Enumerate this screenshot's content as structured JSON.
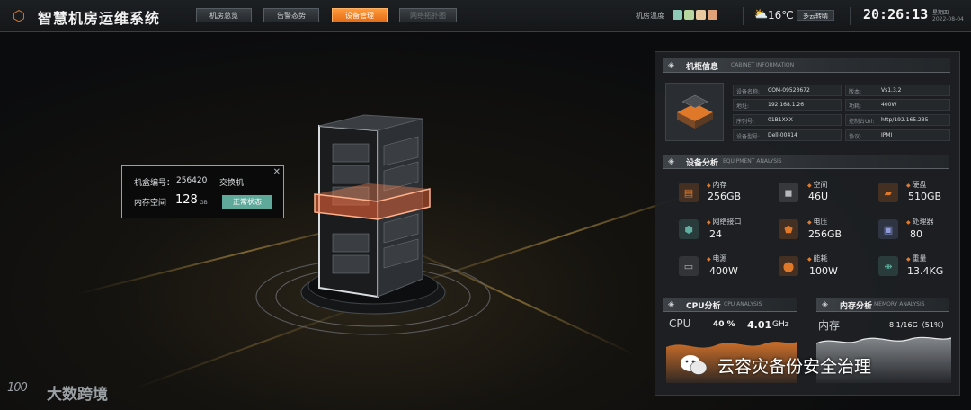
{
  "header": {
    "app_title": "智慧机房运维系统",
    "nav_items": [
      {
        "label": "机房总览",
        "state": "normal"
      },
      {
        "label": "告警态势",
        "state": "normal"
      },
      {
        "label": "设备管理",
        "state": "active"
      },
      {
        "label": "网络拓扑图",
        "state": "dim"
      }
    ],
    "temperature_label": "机房温度",
    "temperature_colors": [
      "#8fc9b8",
      "#b8d7a0",
      "#e8c9a0",
      "#e0a278"
    ],
    "weather_icon": "partly-cloudy-icon",
    "weather_temp": "16℃",
    "weather_desc": "多云转晴",
    "clock": "20:26:13",
    "weekday": "星期四",
    "date": "2022-08-04"
  },
  "popup": {
    "box_no_label": "机盒编号：",
    "box_no_value": "256420",
    "device_type": "交换机",
    "memory_label": "内存空间",
    "memory_value": "128",
    "memory_unit": "GB",
    "status_button": "正常状态",
    "close_icon": "close-icon"
  },
  "cabinet_info": {
    "title_cn": "机柜信息",
    "title_en": "CABINET INFORMATION",
    "fields_left": [
      {
        "key": "设备名称:",
        "value": "COM-09523672"
      },
      {
        "key": "地址:",
        "value": "192.168.1.26"
      },
      {
        "key": "序列号:",
        "value": "01B1XXX"
      },
      {
        "key": "设备型号:",
        "value": "Dell-00414"
      }
    ],
    "fields_right": [
      {
        "key": "版本:",
        "value": "Vs1.3.2"
      },
      {
        "key": "功耗:",
        "value": "400W"
      },
      {
        "key": "控制台Url:",
        "value": "http/192.165.235"
      },
      {
        "key": "协议:",
        "value": "IPMI"
      }
    ]
  },
  "equipment": {
    "title_cn": "设备分析",
    "title_en": "EQUIPMENT ANALYSIS",
    "items": [
      {
        "label": "内存",
        "value": "256GB",
        "icon": "memory-icon",
        "color": "#e0782a"
      },
      {
        "label": "空间",
        "value": "46U",
        "icon": "cube-icon",
        "color": "#9a9ea2"
      },
      {
        "label": "硬盘",
        "value": "510GB",
        "icon": "disk-icon",
        "color": "#e0782a"
      },
      {
        "label": "网络接口",
        "value": "24",
        "icon": "network-icon",
        "color": "#5fb0a0"
      },
      {
        "label": "电压",
        "value": "256GB",
        "icon": "voltage-icon",
        "color": "#e0782a"
      },
      {
        "label": "处理器",
        "value": "80",
        "icon": "cpu-icon",
        "color": "#7f8cc8"
      },
      {
        "label": "电源",
        "value": "400W",
        "icon": "power-supply-icon",
        "color": "#8a8e92"
      },
      {
        "label": "能耗",
        "value": "100W",
        "icon": "energy-icon",
        "color": "#e0782a"
      },
      {
        "label": "重量",
        "value": "13.4KG",
        "icon": "dumbbell-icon",
        "color": "#5fb0a0"
      }
    ]
  },
  "cpu": {
    "title_cn": "CPU分析",
    "title_en": "CPU ANALYSIS",
    "label": "CPU",
    "usage": "40 %",
    "freq": "4.01",
    "freq_unit": "GHz"
  },
  "memory": {
    "title_cn": "内存分析",
    "title_en": "MEMORY ANALYSIS",
    "label": "内存",
    "usage": "8.1/16G（51%）"
  },
  "watermark": "云容灾备份安全治理",
  "brand": "大数跨境",
  "brand_logo": "100"
}
